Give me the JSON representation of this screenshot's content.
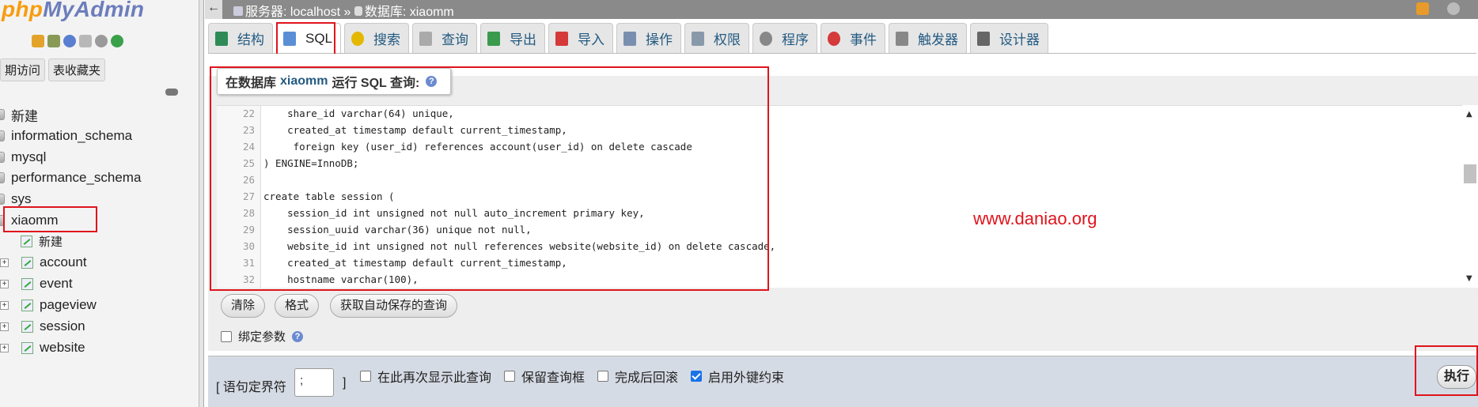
{
  "sidebar": {
    "logo_left": "php",
    "logo_right": "MyAdmin",
    "icons": [
      "home-icon",
      "database-icon",
      "help-icon",
      "docs-icon",
      "settings-icon",
      "reload-icon"
    ],
    "tabs": [
      "期访问",
      "表收藏夹"
    ],
    "new_label": "新建",
    "databases": [
      "information_schema",
      "mysql",
      "performance_schema",
      "sys",
      "xiaomm"
    ],
    "xiaomm_new": "新建",
    "tables": [
      "account",
      "event",
      "pageview",
      "session",
      "website"
    ]
  },
  "topbar": {
    "back_label": "←",
    "server_label": "服务器: localhost",
    "separator": "»",
    "db_label": "数据库: xiaomm"
  },
  "tabs": [
    {
      "label": "结构",
      "icon": "structure-icon",
      "color": "#2e8b57"
    },
    {
      "label": "SQL",
      "icon": "sql-icon",
      "color": "#5a8fd6"
    },
    {
      "label": "搜索",
      "icon": "search-icon",
      "color": "#e5b800"
    },
    {
      "label": "查询",
      "icon": "query-icon",
      "color": "#aaaaaa"
    },
    {
      "label": "导出",
      "icon": "export-icon",
      "color": "#3a9b4e"
    },
    {
      "label": "导入",
      "icon": "import-icon",
      "color": "#d43a3a"
    },
    {
      "label": "操作",
      "icon": "wrench-icon",
      "color": "#7a8fb0"
    },
    {
      "label": "权限",
      "icon": "privileges-icon",
      "color": "#8899aa"
    },
    {
      "label": "程序",
      "icon": "routines-icon",
      "color": "#888888"
    },
    {
      "label": "事件",
      "icon": "events-icon",
      "color": "#d43a3a"
    },
    {
      "label": "触发器",
      "icon": "triggers-icon",
      "color": "#888888"
    },
    {
      "label": "设计器",
      "icon": "designer-icon",
      "color": "#666666"
    }
  ],
  "query": {
    "legend_prefix": "在数据库",
    "legend_db": "xiaomm",
    "legend_suffix": "运行 SQL 查询:",
    "help_label": "?"
  },
  "editor_lines": [
    {
      "n": "22",
      "t": "    share_id varchar(64) unique,"
    },
    {
      "n": "23",
      "t": "    created_at timestamp default current_timestamp,"
    },
    {
      "n": "24",
      "t": "     foreign key (user_id) references account(user_id) on delete cascade"
    },
    {
      "n": "25",
      "t": ") ENGINE=InnoDB;"
    },
    {
      "n": "26",
      "t": ""
    },
    {
      "n": "27",
      "t": "create table session ("
    },
    {
      "n": "28",
      "t": "    session_id int unsigned not null auto_increment primary key,"
    },
    {
      "n": "29",
      "t": "    session_uuid varchar(36) unique not null,"
    },
    {
      "n": "30",
      "t": "    website_id int unsigned not null references website(website_id) on delete cascade,"
    },
    {
      "n": "31",
      "t": "    created_at timestamp default current_timestamp,"
    },
    {
      "n": "32",
      "t": "    hostname varchar(100),"
    }
  ],
  "watermark": "www.daniao.org",
  "buttons": {
    "clear": "清除",
    "format": "格式",
    "autosave": "获取自动保存的查询"
  },
  "bind_params": "绑定参数",
  "bottom": {
    "delimiter_label": "[ 语句定界符",
    "delimiter_value": ";",
    "delimiter_close": "]",
    "opt1": "在此再次显示此查询",
    "opt2": "保留查询框",
    "opt3": "完成后回滚",
    "opt4": "启用外键约束",
    "go": "执行"
  },
  "colors": {
    "accent_red": "#e0141c",
    "link_blue": "#235a81",
    "logo_orange": "#f89c0e",
    "logo_blue": "#6c7dbd"
  }
}
